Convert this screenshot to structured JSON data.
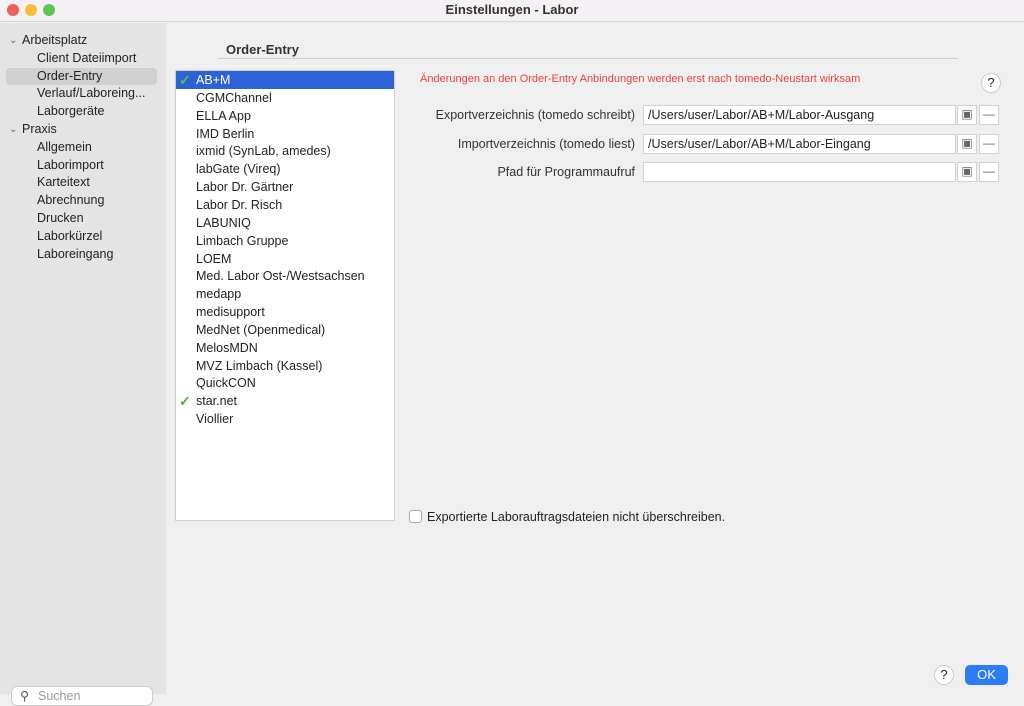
{
  "window": {
    "title": "Einstellungen - Labor"
  },
  "sidebar": {
    "groups": [
      {
        "label": "Arbeitsplatz",
        "items": [
          "Client Dateiimport",
          "Order-Entry",
          "Verlauf/Laboreing...",
          "Laborgeräte"
        ]
      },
      {
        "label": "Praxis",
        "items": [
          "Allgemein",
          "Laborimport",
          "Karteitext",
          "Abrechnung",
          "Drucken",
          "Laborkürzel",
          "Laboreingang"
        ]
      }
    ],
    "selected": "Order-Entry",
    "search_placeholder": "Suchen"
  },
  "main": {
    "section_title": "Order-Entry",
    "notice": "Änderungen an den Order-Entry Anbindungen werden erst nach tomedo-Neustart wirksam",
    "labs": [
      {
        "name": "AB+M",
        "checked": true,
        "selected": true
      },
      {
        "name": "CGMChannel"
      },
      {
        "name": "ELLA App"
      },
      {
        "name": "IMD Berlin"
      },
      {
        "name": "ixmid (SynLab, amedes)"
      },
      {
        "name": "labGate (Vireq)"
      },
      {
        "name": "Labor Dr. Gärtner"
      },
      {
        "name": "Labor Dr. Risch"
      },
      {
        "name": "LABUNIQ"
      },
      {
        "name": "Limbach Gruppe"
      },
      {
        "name": "LOEM"
      },
      {
        "name": "Med. Labor Ost-/Westsachsen"
      },
      {
        "name": "medapp"
      },
      {
        "name": "medisupport"
      },
      {
        "name": "MedNet (Openmedical)"
      },
      {
        "name": "MelosMDN"
      },
      {
        "name": "MVZ Limbach (Kassel)"
      },
      {
        "name": "QuickCON"
      },
      {
        "name": "star.net",
        "checked": true
      },
      {
        "name": "Viollier"
      }
    ],
    "fields": [
      {
        "label": "Exportverzeichnis (tomedo schreibt)",
        "value": "/Users/user/Labor/AB+M/Labor-Ausgang"
      },
      {
        "label": "Importverzeichnis (tomedo liest)",
        "value": "/Users/user/Labor/AB+M/Labor-Eingang"
      },
      {
        "label": "Pfad für Programmaufruf",
        "value": ""
      }
    ],
    "checkbox_label": "Exportierte Laborauftragsdateien nicht überschreiben.",
    "checkbox_checked": false,
    "help": "?",
    "ok": "OK",
    "remove": "—"
  }
}
